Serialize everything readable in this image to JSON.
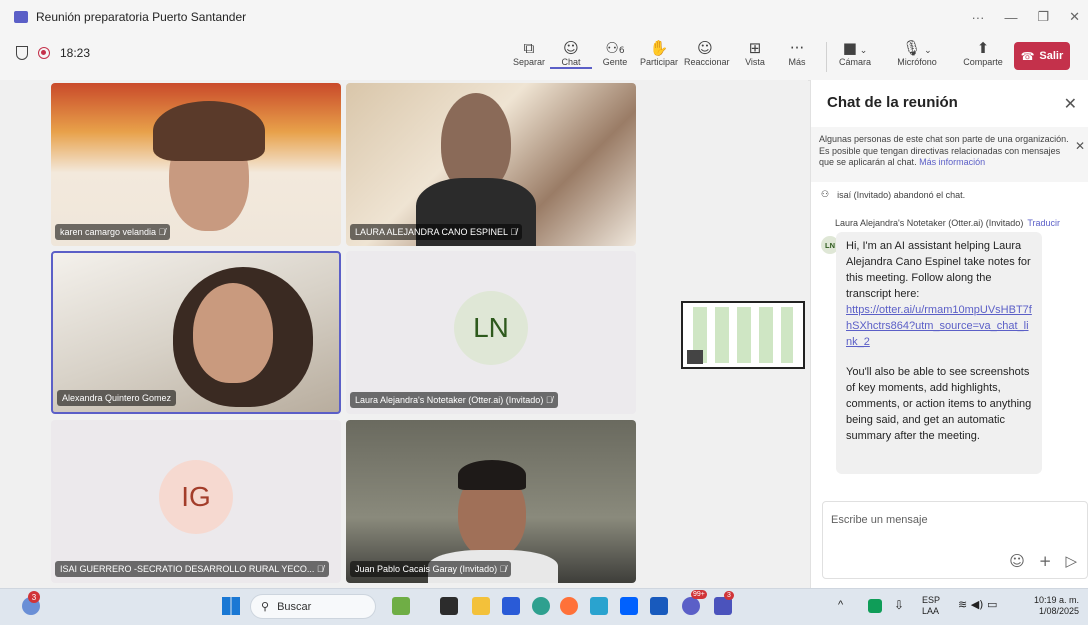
{
  "window": {
    "title": "Reunión preparatoria Puerto Santander"
  },
  "toolbar": {
    "timer": "18:23",
    "items": [
      {
        "label": "Separar"
      },
      {
        "label": "Chat"
      },
      {
        "label": "Gente",
        "count": "6"
      },
      {
        "label": "Participar"
      },
      {
        "label": "Reaccionar"
      },
      {
        "label": "Vista"
      },
      {
        "label": "Más"
      },
      {
        "label": "Cámara"
      },
      {
        "label": "Micrófono"
      },
      {
        "label": "Comparte"
      }
    ],
    "leave_label": "Salir",
    "accent": "#5b5fc7",
    "leave_color": "#c4314b"
  },
  "participants": [
    {
      "name": "karen camargo velandia"
    },
    {
      "name": "LAURA ALEJANDRA CANO ESPINEL"
    },
    {
      "name": "Alexandra Quintero Gomez"
    },
    {
      "name": "Laura Alejandra's Notetaker (Otter.ai) (Invitado)",
      "initials": "LN"
    },
    {
      "name": "ISAI GUERRERO -SECRATIO DESARROLLO RURAL YECO...",
      "initials": "IG"
    },
    {
      "name": "Juan Pablo Cacais Garay (Invitado)"
    }
  ],
  "chat": {
    "title": "Chat de la reunión",
    "notice_text": "Algunas personas de este chat son parte de una organización. Es posible que tengan directivas relacionadas con mensajes que se aplicarán al chat.",
    "notice_link": "Más información",
    "system_message": "isaí (Invitado) abandonó el chat.",
    "sender": "Laura Alejandra's Notetaker (Otter.ai) (Invitado)",
    "translate": "Traducir",
    "avatar_initials": "LN",
    "message_p1": "Hi, I'm an AI assistant helping Laura Alejandra Cano Espinel take notes for this meeting. Follow along the transcript here:",
    "message_link": "https://otter.ai/u/rmam10mpUVsHBT7fhSXhctrs864?utm_source=va_chat_link_2",
    "message_p2": "You'll also be able to see screenshots of key moments, add highlights, comments, or action items to anything being said, and get an automatic summary after the meeting.",
    "compose_placeholder": "Escribe un mensaje"
  },
  "taskbar": {
    "badge_count": "3",
    "search_label": "Buscar",
    "teams_badge": "99+",
    "teams2_badge": "3",
    "lang_line1": "ESP",
    "lang_line2": "LAA",
    "time": "10:19 a. m.",
    "date": "1/08/2025"
  }
}
